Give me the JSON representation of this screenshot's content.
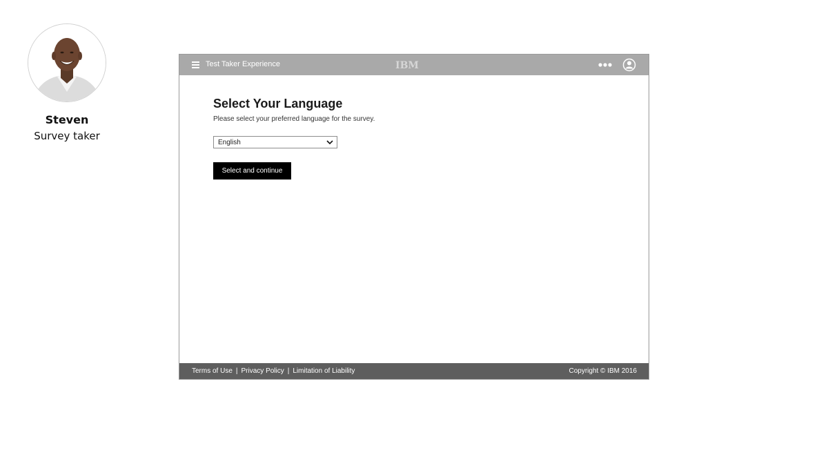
{
  "persona": {
    "name": "Steven",
    "role": "Survey taker"
  },
  "header": {
    "title": "Test Taker Experience",
    "logo": "IBM",
    "icons": [
      "hamburger-menu-icon",
      "more-options-icon",
      "user-profile-icon"
    ]
  },
  "main": {
    "title": "Select Your Language",
    "subtitle": "Please select your preferred language for the survey.",
    "language_select": {
      "selected": "English"
    },
    "continue_label": "Select and continue"
  },
  "footer": {
    "links": [
      "Terms of Use",
      "Privacy Policy",
      "Limitation of Liability"
    ],
    "separator": "|",
    "copyright": "Copyright © IBM 2016"
  },
  "colors": {
    "header_bg": "#a9a9a9",
    "footer_bg": "#5e5e5e",
    "button_bg": "#000000"
  }
}
